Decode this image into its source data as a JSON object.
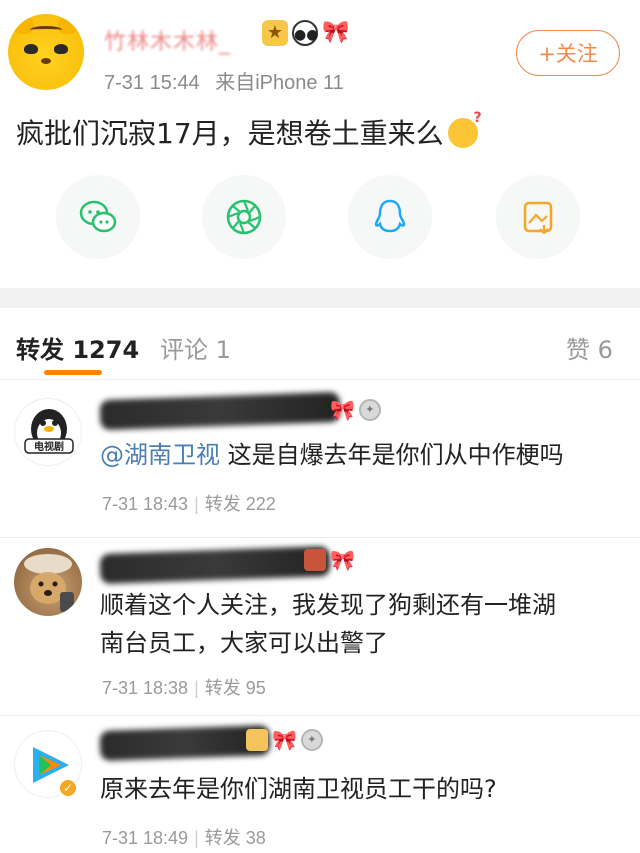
{
  "post": {
    "username": "竹林木木林_",
    "time": "7-31 15:44",
    "source": "来自iPhone 11",
    "follow_label": "+关注",
    "text": "疯批们沉寂17月，是想卷土重来么",
    "share_icons": [
      "wechat-icon",
      "moments-icon",
      "qq-icon",
      "save-image-icon"
    ],
    "colors": {
      "accent": "#ff8200",
      "follow": "#f08a4a",
      "mention": "#4a7eb5"
    }
  },
  "tabs": {
    "repost": "转发 1274",
    "comment": "评论 1",
    "like": "赞 6"
  },
  "comments": [
    {
      "mention": "@湖南卫视",
      "text": " 这是自爆去年是你们从中作梗吗",
      "time": "7-31 18:43",
      "repost": "转发 222"
    },
    {
      "text_line1": "顺着这个人关注，我发现了狗剩还有一堆湖",
      "text_line2": "南台员工，大家可以出警了",
      "time": "7-31 18:38",
      "repost": "转发 95"
    },
    {
      "text": "原来去年是你们湖南卫视员工干的吗?",
      "time": "7-31 18:49",
      "repost": "转发 38"
    }
  ]
}
